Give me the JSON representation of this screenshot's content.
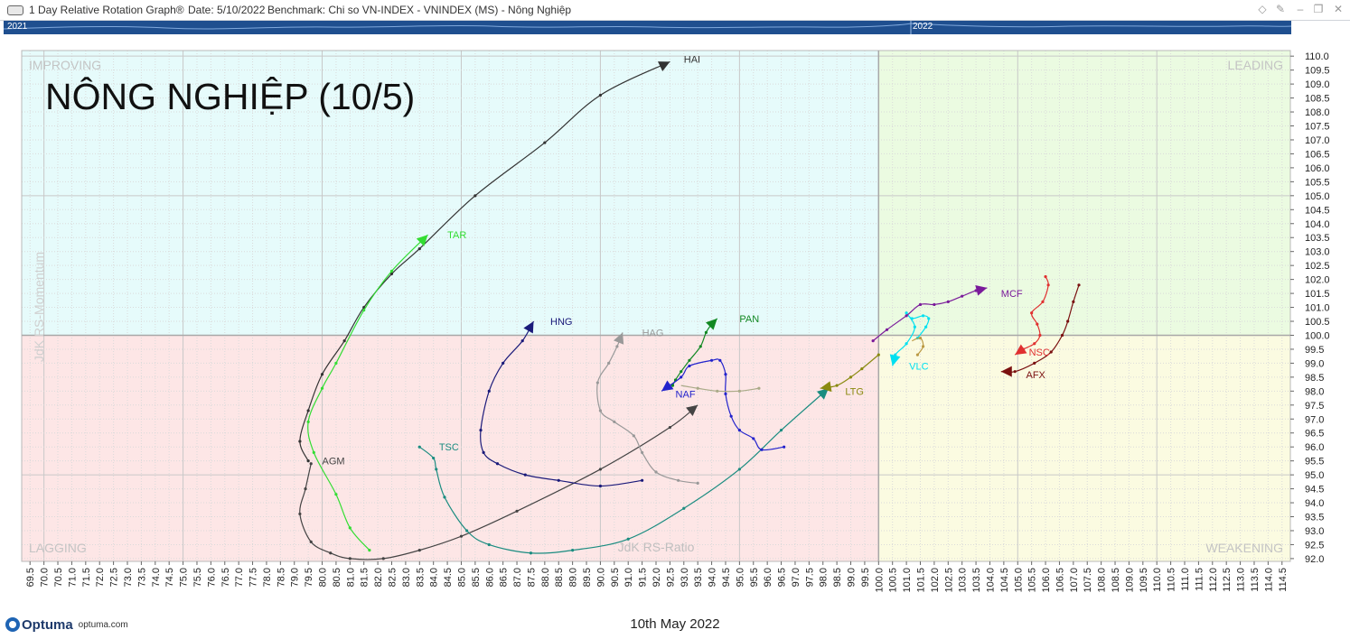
{
  "window": {
    "title": "1 Day Relative Rotation Graph®",
    "date_label": "Date: 5/10/2022",
    "benchmark_label": "Benchmark:  Chi so VN-INDEX - VNINDEX (MS) - Nông Nghiệp"
  },
  "timeline": {
    "years": [
      "2021",
      "2022"
    ]
  },
  "footer": {
    "brand": "Optuma",
    "site": "optuma.com",
    "date": "10th May 2022"
  },
  "chart_data": {
    "type": "scatter",
    "title": "NÔNG NGHIỆP (10/5)",
    "xlabel": "JdK RS-Ratio",
    "ylabel": "JdK RS-Momentum",
    "xlim": [
      69.2,
      114.8
    ],
    "ylim": [
      91.9,
      110.2
    ],
    "xticks": [
      "69.5",
      "70.0",
      "70.5",
      "71.0",
      "71.5",
      "72.0",
      "72.5",
      "73.0",
      "73.5",
      "74.0",
      "74.5",
      "75.0",
      "75.5",
      "76.0",
      "76.5",
      "77.0",
      "77.5",
      "78.0",
      "78.5",
      "79.0",
      "79.5",
      "80.0",
      "80.5",
      "81.0",
      "81.5",
      "82.0",
      "82.5",
      "83.0",
      "83.5",
      "84.0",
      "84.5",
      "85.0",
      "85.5",
      "86.0",
      "86.5",
      "87.0",
      "87.5",
      "88.0",
      "88.5",
      "89.0",
      "89.5",
      "90.0",
      "90.5",
      "91.0",
      "91.5",
      "92.0",
      "92.5",
      "93.0",
      "93.5",
      "94.0",
      "94.5",
      "95.0",
      "95.5",
      "96.0",
      "96.5",
      "97.0",
      "97.5",
      "98.0",
      "98.5",
      "99.0",
      "99.5",
      "100.0",
      "100.5",
      "101.0",
      "101.5",
      "102.0",
      "102.5",
      "103.0",
      "103.5",
      "104.0",
      "104.5",
      "105.0",
      "105.5",
      "106.0",
      "106.5",
      "107.0",
      "107.5",
      "108.0",
      "108.5",
      "109.0",
      "109.5",
      "110.0",
      "110.5",
      "111.0",
      "111.5",
      "112.0",
      "112.5",
      "113.0",
      "113.5",
      "114.0",
      "114.5"
    ],
    "yticks": [
      "92.0",
      "92.5",
      "93.0",
      "93.5",
      "94.0",
      "94.5",
      "95.0",
      "95.5",
      "96.0",
      "96.5",
      "97.0",
      "97.5",
      "98.0",
      "98.5",
      "99.0",
      "99.5",
      "100.0",
      "100.5",
      "101.0",
      "101.5",
      "102.0",
      "102.5",
      "103.0",
      "103.5",
      "104.0",
      "104.5",
      "105.0",
      "105.5",
      "106.0",
      "106.5",
      "107.0",
      "107.5",
      "108.0",
      "108.5",
      "109.0",
      "109.5",
      "110.0"
    ],
    "quadrants": {
      "improving": "IMPROVING",
      "leading": "LEADING",
      "lagging": "LAGGING",
      "weakening": "WEAKENING",
      "colors": {
        "improving": "#e6fbfb",
        "leading": "#ebfbe1",
        "lagging": "#fde6e6",
        "weakening": "#fbfbe1"
      }
    },
    "center": [
      100,
      100
    ],
    "grid": true,
    "series": [
      {
        "name": "HAI",
        "color": "#333333",
        "points": [
          [
            79.5,
            95.5
          ],
          [
            79.2,
            96.2
          ],
          [
            79.5,
            97.3
          ],
          [
            80.0,
            98.6
          ],
          [
            80.8,
            99.8
          ],
          [
            81.5,
            101.0
          ],
          [
            82.5,
            102.2
          ],
          [
            83.5,
            103.1
          ],
          [
            85.5,
            105.0
          ],
          [
            88.0,
            106.9
          ],
          [
            90.0,
            108.6
          ],
          [
            92.5,
            109.8
          ]
        ]
      },
      {
        "name": "TAR",
        "color": "#33dd33",
        "points": [
          [
            81.7,
            92.3
          ],
          [
            81.0,
            93.1
          ],
          [
            80.5,
            94.3
          ],
          [
            79.7,
            95.8
          ],
          [
            79.5,
            96.9
          ],
          [
            80.0,
            98.1
          ],
          [
            80.5,
            99.0
          ],
          [
            81.5,
            100.9
          ],
          [
            82.5,
            102.3
          ],
          [
            83.8,
            103.6
          ]
        ]
      },
      {
        "name": "AGM",
        "color": "#444444",
        "points": [
          [
            79.6,
            95.4
          ],
          [
            79.4,
            94.5
          ],
          [
            79.2,
            93.6
          ],
          [
            79.6,
            92.6
          ],
          [
            80.3,
            92.2
          ],
          [
            81.0,
            92.0
          ],
          [
            82.2,
            92.0
          ],
          [
            83.5,
            92.3
          ],
          [
            85.0,
            92.8
          ],
          [
            87.0,
            93.7
          ],
          [
            90.0,
            95.2
          ],
          [
            92.5,
            96.7
          ],
          [
            93.5,
            97.5
          ]
        ]
      },
      {
        "name": "TSC",
        "color": "#1a8c80",
        "points": [
          [
            83.5,
            96.0
          ],
          [
            84.0,
            95.6
          ],
          [
            84.1,
            95.2
          ],
          [
            84.4,
            94.2
          ],
          [
            85.2,
            93.0
          ],
          [
            86.0,
            92.5
          ],
          [
            87.5,
            92.2
          ],
          [
            89.0,
            92.3
          ],
          [
            91.0,
            92.7
          ],
          [
            93.0,
            93.8
          ],
          [
            95.0,
            95.2
          ],
          [
            96.5,
            96.6
          ],
          [
            98.2,
            98.1
          ]
        ]
      },
      {
        "name": "HNG",
        "color": "#1a1a7a",
        "points": [
          [
            91.5,
            94.8
          ],
          [
            90.0,
            94.6
          ],
          [
            88.5,
            94.8
          ],
          [
            87.3,
            95.0
          ],
          [
            86.3,
            95.4
          ],
          [
            85.8,
            95.8
          ],
          [
            85.7,
            96.6
          ],
          [
            86.0,
            98.0
          ],
          [
            86.5,
            99.0
          ],
          [
            87.2,
            99.8
          ],
          [
            87.6,
            100.5
          ]
        ]
      },
      {
        "name": "HAG",
        "color": "#999999",
        "points": [
          [
            93.5,
            94.7
          ],
          [
            92.8,
            94.8
          ],
          [
            92.0,
            95.1
          ],
          [
            91.5,
            95.8
          ],
          [
            91.2,
            96.4
          ],
          [
            90.5,
            96.9
          ],
          [
            90.0,
            97.3
          ],
          [
            89.9,
            98.3
          ],
          [
            90.3,
            99.0
          ],
          [
            90.6,
            99.6
          ],
          [
            90.8,
            100.1
          ]
        ]
      },
      {
        "name": "PAN",
        "color": "#118822",
        "points": [
          [
            92.6,
            98.2
          ],
          [
            92.7,
            98.4
          ],
          [
            92.9,
            98.7
          ],
          [
            93.2,
            99.1
          ],
          [
            93.6,
            99.6
          ],
          [
            93.8,
            100.1
          ],
          [
            94.0,
            100.4
          ],
          [
            94.2,
            100.6
          ]
        ]
      },
      {
        "name": "NAF",
        "color": "#2222cc",
        "points": [
          [
            96.6,
            96.0
          ],
          [
            95.8,
            95.9
          ],
          [
            95.5,
            96.3
          ],
          [
            95.0,
            96.6
          ],
          [
            94.7,
            97.1
          ],
          [
            94.5,
            97.9
          ],
          [
            94.5,
            98.6
          ],
          [
            94.3,
            99.1
          ],
          [
            94.0,
            99.1
          ],
          [
            93.2,
            98.9
          ],
          [
            92.9,
            98.5
          ],
          [
            92.2,
            98.0
          ]
        ]
      },
      {
        "name": "NAF tail",
        "color": "#aaaa88",
        "points": [
          [
            95.7,
            98.1
          ],
          [
            95.0,
            98.0
          ],
          [
            94.2,
            98.0
          ],
          [
            93.5,
            98.1
          ],
          [
            92.9,
            98.2
          ]
        ]
      },
      {
        "name": "LTG",
        "color": "#8a8a10",
        "points": [
          [
            100.0,
            99.3
          ],
          [
            99.4,
            98.8
          ],
          [
            99.0,
            98.5
          ],
          [
            98.5,
            98.2
          ],
          [
            97.9,
            98.1
          ]
        ]
      },
      {
        "name": "VLC",
        "color": "#00e0f0",
        "points": [
          [
            101.4,
            99.9
          ],
          [
            101.7,
            100.3
          ],
          [
            101.8,
            100.6
          ],
          [
            101.6,
            100.7
          ],
          [
            101.2,
            100.6
          ],
          [
            101.0,
            100.8
          ],
          [
            101.3,
            100.3
          ],
          [
            101.0,
            99.7
          ],
          [
            100.6,
            99.3
          ],
          [
            100.5,
            98.9
          ]
        ]
      },
      {
        "name": "MCF",
        "color": "#7a1a9a",
        "points": [
          [
            99.8,
            99.8
          ],
          [
            100.3,
            100.2
          ],
          [
            101.0,
            100.7
          ],
          [
            101.5,
            101.1
          ],
          [
            102.0,
            101.1
          ],
          [
            102.5,
            101.2
          ],
          [
            103.0,
            101.4
          ],
          [
            103.5,
            101.6
          ],
          [
            103.9,
            101.7
          ]
        ]
      },
      {
        "name": "NSC",
        "color": "#e03030",
        "points": [
          [
            106.0,
            102.1
          ],
          [
            106.1,
            101.8
          ],
          [
            105.9,
            101.2
          ],
          [
            105.5,
            100.8
          ],
          [
            105.7,
            100.4
          ],
          [
            105.8,
            100.0
          ],
          [
            105.6,
            99.7
          ],
          [
            105.2,
            99.5
          ],
          [
            104.9,
            99.3
          ]
        ]
      },
      {
        "name": "AFX",
        "color": "#7a1010",
        "points": [
          [
            107.2,
            101.8
          ],
          [
            107.0,
            101.2
          ],
          [
            106.8,
            100.5
          ],
          [
            106.6,
            100.0
          ],
          [
            106.2,
            99.4
          ],
          [
            105.6,
            99.0
          ],
          [
            104.9,
            98.7
          ],
          [
            104.4,
            98.7
          ]
        ]
      },
      {
        "name": "LTG tail",
        "color": "#bb9944",
        "points": [
          [
            101.4,
            99.3
          ],
          [
            101.6,
            99.6
          ],
          [
            101.5,
            99.9
          ],
          [
            101.2,
            99.8
          ]
        ]
      }
    ],
    "labels": [
      {
        "series": "HAI",
        "text": "HAI",
        "at": [
          93.0,
          109.9
        ]
      },
      {
        "series": "TAR",
        "text": "TAR",
        "at": [
          84.5,
          103.6
        ]
      },
      {
        "series": "AGM",
        "text": "AGM",
        "at": [
          80.0,
          95.5
        ]
      },
      {
        "series": "TSC",
        "text": "TSC",
        "at": [
          84.2,
          96.0
        ]
      },
      {
        "series": "HNG",
        "text": "HNG",
        "at": [
          88.2,
          100.5
        ]
      },
      {
        "series": "HAG",
        "text": "HAG",
        "at": [
          91.5,
          100.1
        ]
      },
      {
        "series": "PAN",
        "text": "PAN",
        "at": [
          95.0,
          100.6
        ]
      },
      {
        "series": "NAF",
        "text": "NAF",
        "at": [
          92.7,
          97.9
        ]
      },
      {
        "series": "LTG",
        "text": "LTG",
        "at": [
          98.8,
          98.0
        ]
      },
      {
        "series": "VLC",
        "text": "VLC",
        "at": [
          101.1,
          98.9
        ]
      },
      {
        "series": "MCF",
        "text": "MCF",
        "at": [
          104.4,
          101.5
        ]
      },
      {
        "series": "NSC",
        "text": "NSC",
        "at": [
          105.4,
          99.4
        ]
      },
      {
        "series": "AFX",
        "text": "AFX",
        "at": [
          105.3,
          98.6
        ]
      }
    ]
  }
}
